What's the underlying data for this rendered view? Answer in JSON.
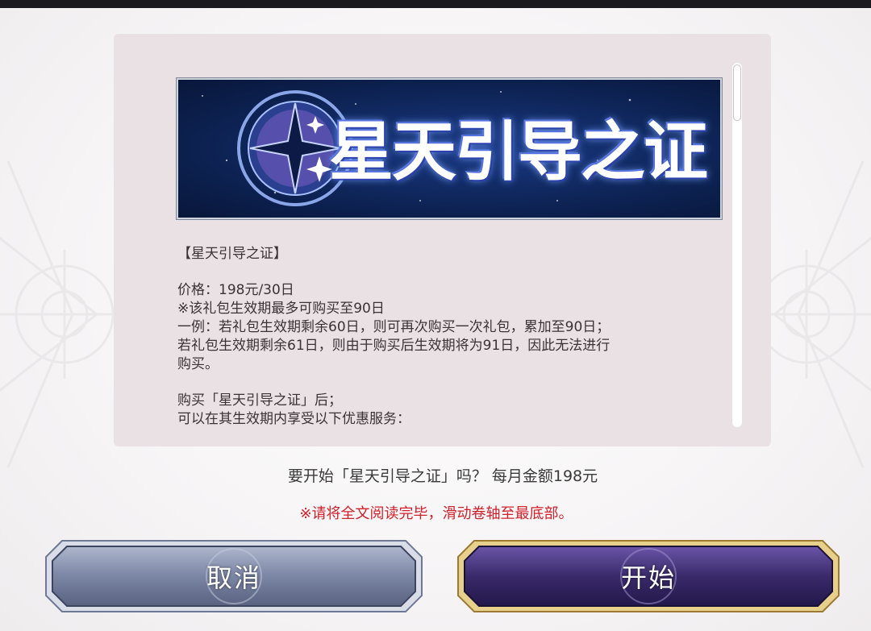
{
  "banner": {
    "title": "星天引导之证"
  },
  "content": {
    "heading": "【星天引导之证】",
    "lines": [
      "价格：198元/30日",
      "※该礼包生效期最多可购买至90日",
      "一例：若礼包生效期剩余60日，则可再次购买一次礼包，累加至90日；",
      "若礼包生效期剩余61日，则由于购买后生效期将为91日，因此无法进行",
      "购买。",
      "购买「星天引导之证」后；",
      "可以在其生效期内享受以下优惠服务："
    ]
  },
  "prompt": "要开始「星天引导之证」吗？ 每月金额198元",
  "warning": "※请将全文阅读完毕，滑动卷轴至最底部。",
  "buttons": {
    "cancel": "取消",
    "start": "开始"
  },
  "colors": {
    "warning": "#d2202b",
    "panel": "#e9e1e4",
    "cancel_button": "#7b86a5",
    "start_button": "#3a2a6a",
    "start_border": "#c9a65a"
  },
  "icons": {
    "banner_emblem": "compass-star-icon",
    "decoration": "ornamental-frame-icon"
  }
}
